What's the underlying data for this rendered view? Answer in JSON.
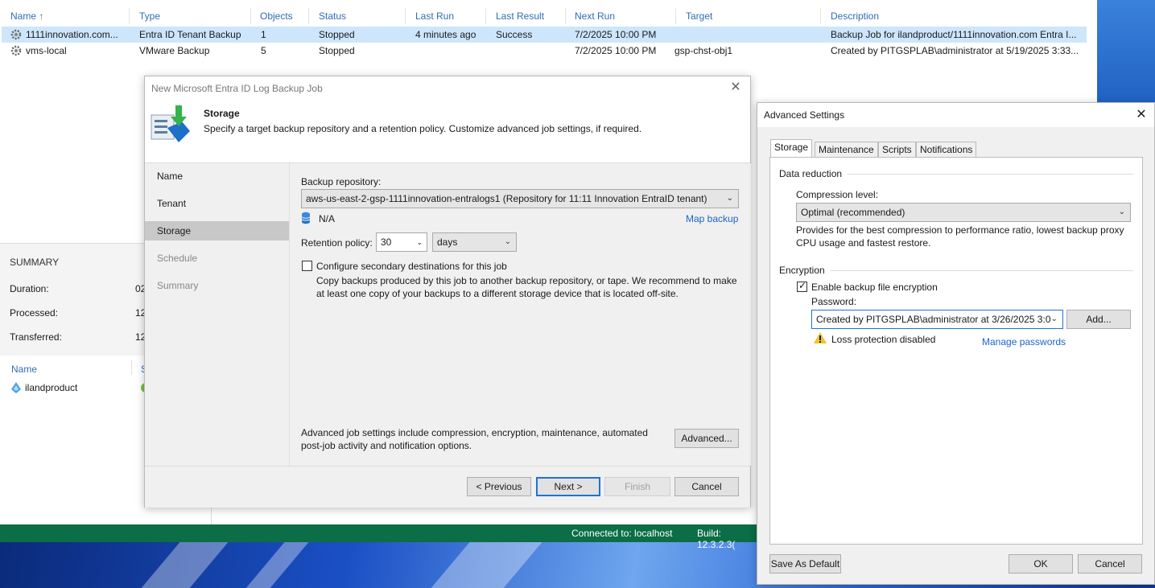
{
  "jobs_grid": {
    "columns": [
      "Name",
      "Type",
      "Objects",
      "Status",
      "Last Run",
      "Last Result",
      "Next Run",
      "Target",
      "Description"
    ],
    "rows": [
      {
        "name": "1111innovation.com...",
        "type": "Entra ID Tenant Backup",
        "objects": "1",
        "status": "Stopped",
        "last_run": "4 minutes ago",
        "last_result": "Success",
        "next_run": "7/2/2025 10:00 PM",
        "target": "",
        "description": "Backup Job for ilandproduct/1111innovation.com Entra I..."
      },
      {
        "name": "vms-local",
        "type": "VMware Backup",
        "objects": "5",
        "status": "Stopped",
        "last_run": "",
        "last_result": "",
        "next_run": "7/2/2025 10:00 PM",
        "target": "gsp-chst-obj1",
        "description": "Created by PITGSPLAB\\administrator at 5/19/2025 3:33..."
      }
    ]
  },
  "summary": {
    "title": "SUMMARY",
    "duration_label": "Duration:",
    "duration_value": "02",
    "processed_label": "Processed:",
    "processed_value": "12",
    "transferred_label": "Transferred:",
    "transferred_value": "12"
  },
  "sublist": {
    "name_header": "Name",
    "status_header": "S",
    "item": "ilandproduct"
  },
  "statusbar": {
    "connected": "Connected to: localhost",
    "build": "Build: 12.3.2.3("
  },
  "wizard": {
    "title": "New Microsoft Entra ID Log Backup Job",
    "header_title": "Storage",
    "header_desc": "Specify a target backup repository and a retention policy. Customize advanced job settings, if required.",
    "steps": [
      "Name",
      "Tenant",
      "Storage",
      "Schedule",
      "Summary"
    ],
    "backup_repo_label": "Backup repository:",
    "backup_repo_value": "aws-us-east-2-gsp-1111innovation-entralogs1 (Repository for 11:11 Innovation EntraID tenant)",
    "repo_size": "N/A",
    "map_backup": "Map backup",
    "retention_label": "Retention policy:",
    "retention_value": "30",
    "retention_unit": "days",
    "secondary_label": "Configure secondary destinations for this job",
    "secondary_desc": "Copy backups produced by this job to another backup repository, or tape. We recommend to make at least one copy of your backups to a different storage device that is located off-site.",
    "advanced_desc": "Advanced job settings include compression, encryption, maintenance, automated post-job activity and notification options.",
    "advanced_button": "Advanced...",
    "prev_button": "< Previous",
    "next_button": "Next >",
    "finish_button": "Finish",
    "cancel_button": "Cancel"
  },
  "advanced": {
    "title": "Advanced Settings",
    "tabs": [
      "Storage",
      "Maintenance",
      "Scripts",
      "Notifications"
    ],
    "data_reduction_label": "Data reduction",
    "compression_label": "Compression level:",
    "compression_value": "Optimal (recommended)",
    "compression_desc": "Provides for the best compression to performance ratio, lowest backup proxy CPU usage and fastest restore.",
    "encryption_label": "Encryption",
    "enable_encryption_label": "Enable backup file encryption",
    "password_label": "Password:",
    "password_value": "Created by PITGSPLAB\\administrator at 3/26/2025 3:0",
    "add_button": "Add...",
    "loss_protection": "Loss protection disabled",
    "manage_passwords": "Manage passwords",
    "save_default_button": "Save As Default",
    "ok_button": "OK",
    "cancel_button": "Cancel"
  }
}
